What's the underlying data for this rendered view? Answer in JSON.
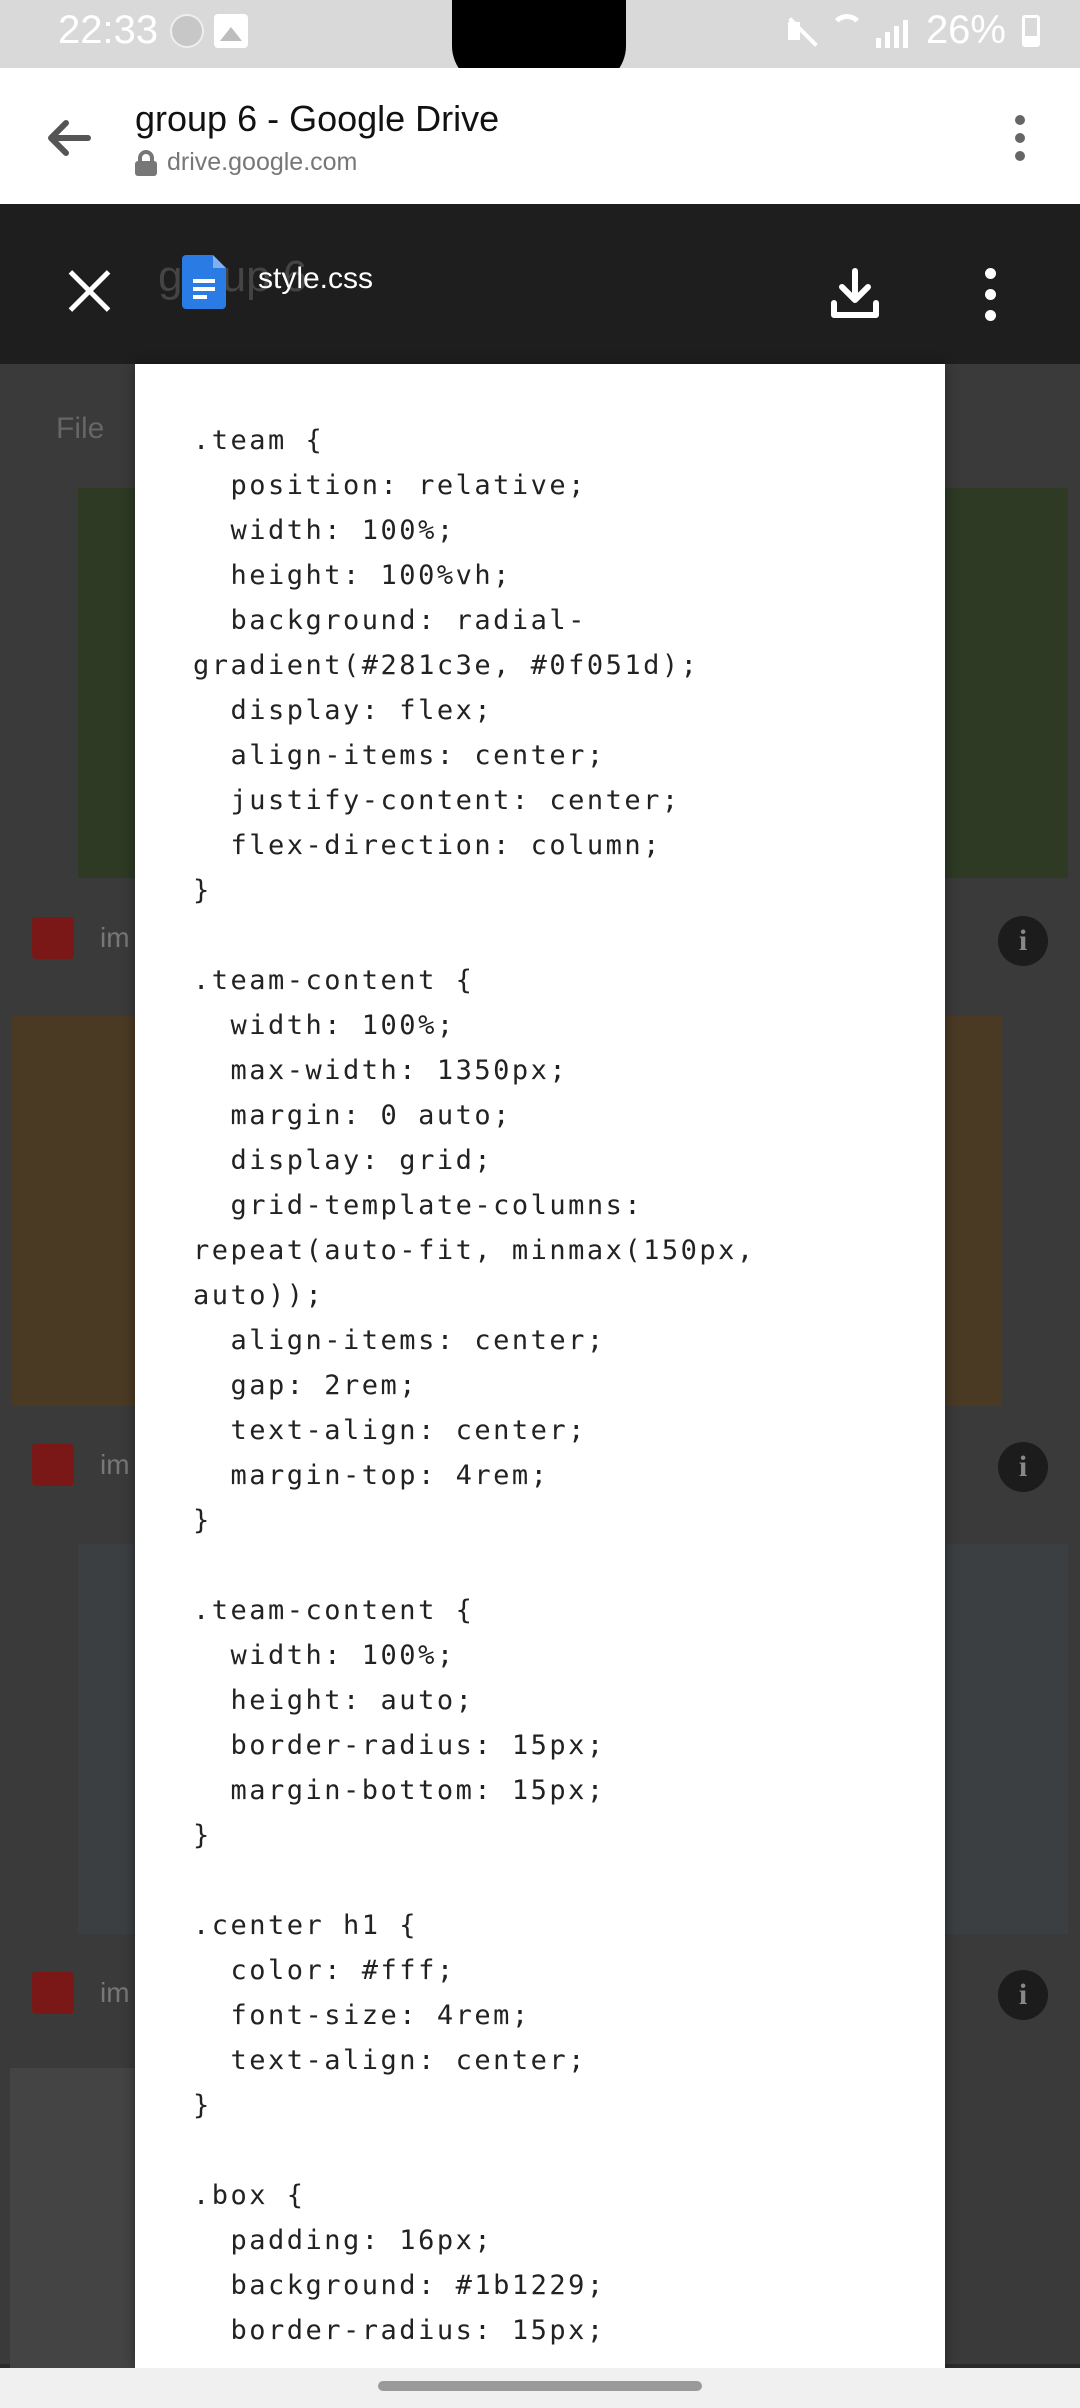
{
  "status_bar": {
    "time": "22:33",
    "battery": "26%"
  },
  "browser": {
    "title": "group 6 - Google Drive",
    "url": "drive.google.com"
  },
  "viewer": {
    "file_name": "style.css",
    "ghost_title": "group 6"
  },
  "background": {
    "file_label": "File",
    "row_text": "im"
  },
  "code_lines": [
    ".team {",
    "  position: relative;",
    "  width: 100%;",
    "  height: 100%vh;",
    "  background: radial-",
    "gradient(#281c3e, #0f051d);",
    "  display: flex;",
    "  align-items: center;",
    "  justify-content: center;",
    "  flex-direction: column;",
    "}",
    "",
    ".team-content {",
    "  width: 100%;",
    "  max-width: 1350px;",
    "  margin: 0 auto;",
    "  display: grid;",
    "  grid-template-columns:",
    "repeat(auto-fit, minmax(150px,",
    "auto));",
    "  align-items: center;",
    "  gap: 2rem;",
    "  text-align: center;",
    "  margin-top: 4rem;",
    "}",
    "",
    ".team-content {",
    "  width: 100%;",
    "  height: auto;",
    "  border-radius: 15px;",
    "  margin-bottom: 15px;",
    "}",
    "",
    ".center h1 {",
    "  color: #fff;",
    "  font-size: 4rem;",
    "  text-align: center;",
    "}",
    "",
    ".box {",
    "  padding: 16px;",
    "  background: #1b1229;",
    "  border-radius: 15px;"
  ]
}
